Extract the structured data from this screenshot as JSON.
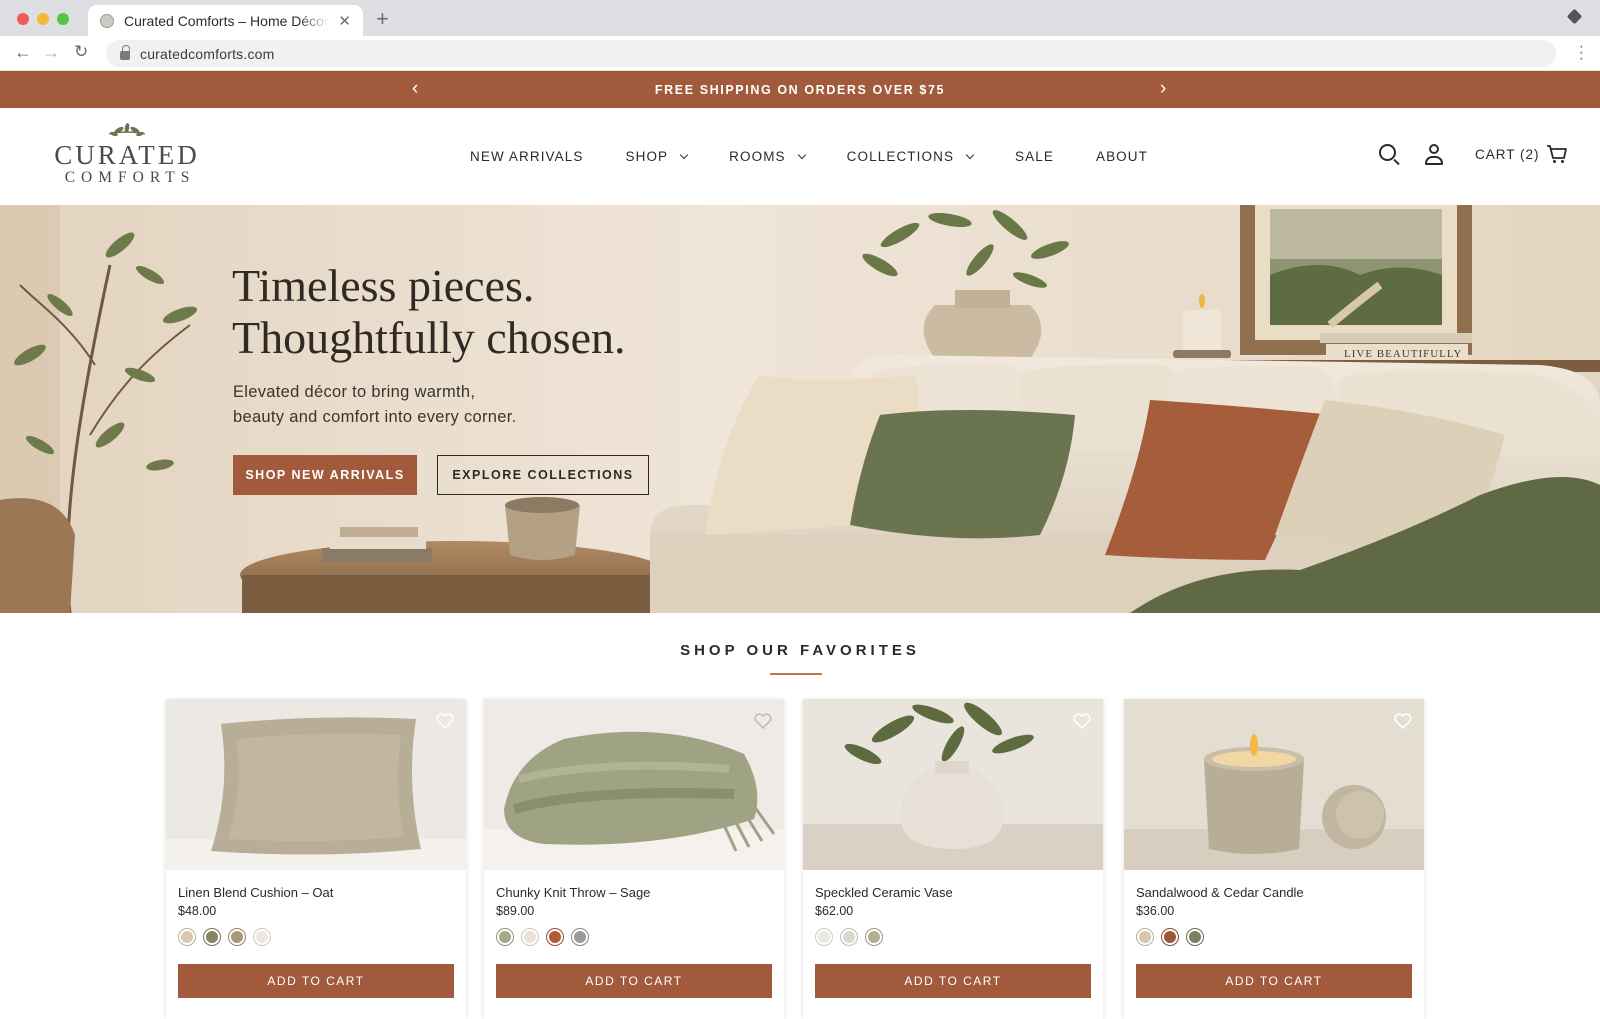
{
  "browser": {
    "tab_title": "Curated Comforts – Home Décor",
    "tab_close": "✕",
    "new_tab": "+",
    "url": "curatedcomforts.com",
    "back": "←",
    "forward": "→",
    "reload": "↻"
  },
  "announcement": {
    "text": "FREE SHIPPING ON ORDERS OVER $75",
    "prev": "‹",
    "next": "›"
  },
  "header": {
    "logo_line1": "CURATED",
    "logo_line2": "COMFORTS",
    "nav": [
      {
        "label": "NEW ARRIVALS",
        "dropdown": false
      },
      {
        "label": "SHOP",
        "dropdown": true
      },
      {
        "label": "ROOMS",
        "dropdown": true
      },
      {
        "label": "COLLECTIONS",
        "dropdown": true
      },
      {
        "label": "SALE",
        "dropdown": false
      },
      {
        "label": "ABOUT",
        "dropdown": false
      }
    ],
    "cart_label": "CART (2)",
    "icons": [
      "search-icon",
      "account-icon",
      "cart-icon"
    ]
  },
  "hero": {
    "title_line1": "Timeless pieces.",
    "title_line2": "Thoughtfully chosen.",
    "subtitle_line1": "Elevated décor to bring warmth,",
    "subtitle_line2": "beauty and comfort into every corner.",
    "primary_cta": "SHOP NEW ARRIVALS",
    "secondary_cta": "EXPLORE COLLECTIONS",
    "book_spine_text": "LIVE BEAUTIFULLY"
  },
  "favorites": {
    "title": "SHOP OUR FAVORITES",
    "products": [
      {
        "name": "Linen Blend Cushion – Oat",
        "price": "$48.00",
        "swatches": [
          "#d8c8b4",
          "#8a8466",
          "#a89878",
          "#ece7e0"
        ],
        "cta": "ADD TO CART"
      },
      {
        "name": "Chunky Knit Throw – Sage",
        "price": "$89.00",
        "swatches": [
          "#a6a888",
          "#ebe3d8",
          "#b05a3a",
          "#9c9c9a"
        ],
        "cta": "ADD TO CART"
      },
      {
        "name": "Speckled Ceramic Vase",
        "price": "$62.00",
        "swatches": [
          "#ece8e2",
          "#dcd8d0",
          "#b2b090"
        ],
        "cta": "ADD TO CART"
      },
      {
        "name": "Sandalwood & Cedar Candle",
        "price": "$36.00",
        "swatches": [
          "#d8c6ae",
          "#9a5a38",
          "#7b7e60"
        ],
        "cta": "ADD TO CART"
      }
    ]
  },
  "colors": {
    "brand": "#a25a3c",
    "text": "#2d2a26",
    "accent_rule": "#b9764f",
    "sage": "#6b7450"
  }
}
